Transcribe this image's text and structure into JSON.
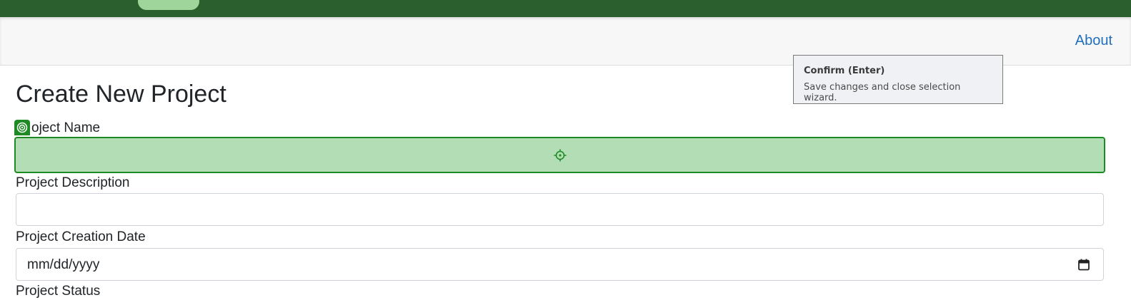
{
  "header": {
    "logo_text": "",
    "colors": {
      "topbar": "#2b5f2e",
      "pill": "#9fd49a"
    }
  },
  "nav": {
    "about_label": "About",
    "about_color": "#1f6fbf"
  },
  "tooltip": {
    "title": "Confirm (Enter)",
    "body": "Save changes and close selection wizard."
  },
  "form": {
    "title": "Create New Project",
    "project_name": {
      "label": "oject Name",
      "value": ""
    },
    "project_description": {
      "label": "Project Description",
      "value": ""
    },
    "project_creation_date": {
      "label": "Project Creation Date",
      "placeholder": "mm/dd/yyyy"
    },
    "project_status": {
      "label": "Project Status"
    }
  },
  "selection": {
    "highlight_color": "#b3ddb5",
    "border_color": "#1e8a24",
    "badge_icon": "target-icon",
    "center_icon": "crosshair-icon"
  }
}
